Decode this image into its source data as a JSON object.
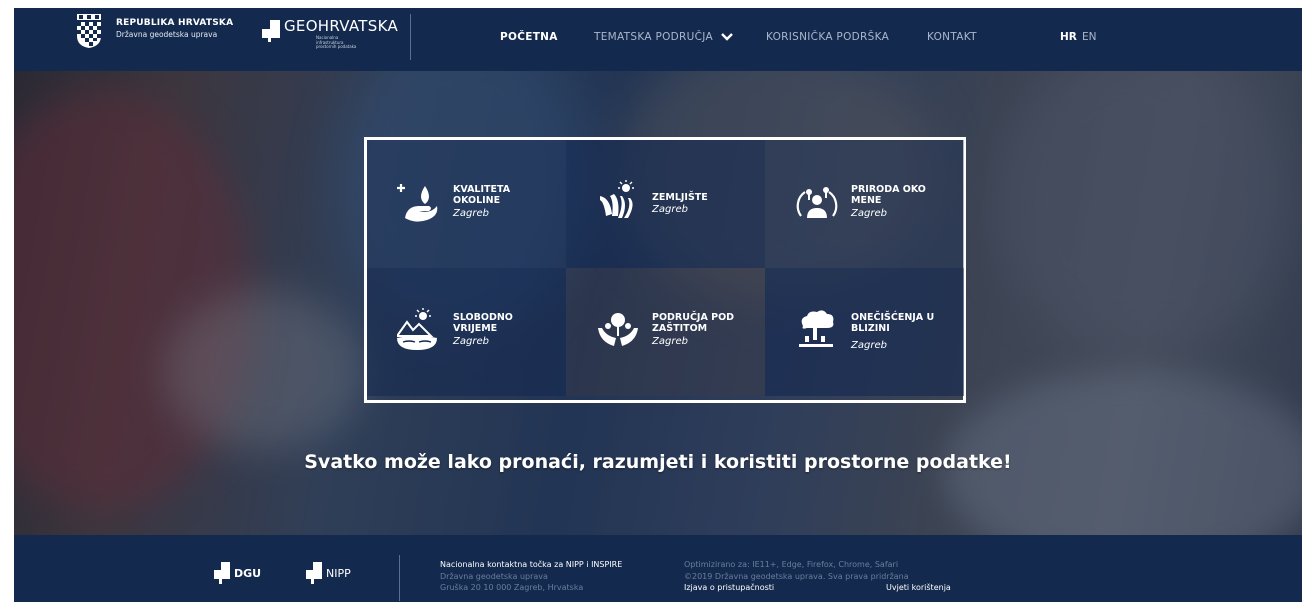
{
  "header": {
    "country": "REPUBLIKA HRVATSKA",
    "agency": "Državna geodetska uprava",
    "geo_title": "GEOHRVATSKA",
    "geo_sub": [
      "Nacionalna infrastruktura",
      "prostornih podataka"
    ],
    "nav": [
      {
        "label": "POČETNA",
        "active": true
      },
      {
        "label": "TEMATSKA PODRUČJA",
        "active": false
      },
      {
        "label": "KORISNIČKA PODRŠKA",
        "active": false
      },
      {
        "label": "KONTAKT",
        "active": false
      }
    ],
    "languages": [
      "HR",
      "EN"
    ]
  },
  "hero": {
    "tiles": [
      {
        "title": "KVALITETA OKOLINE",
        "city": "Zagreb",
        "icon": "hand-drop-icon"
      },
      {
        "title": "ZEMLJIŠTE",
        "city": "Zagreb",
        "icon": "field-sun-icon"
      },
      {
        "title": "PRIRODA OKO MENE",
        "city": "Zagreb",
        "icon": "person-nature-icon"
      },
      {
        "title": "SLOBODNO VRIJEME",
        "city": "Zagreb",
        "icon": "mountain-lake-icon"
      },
      {
        "title": "PODRUČJA POD ZAŠTITOM",
        "city": "Zagreb",
        "icon": "protected-tree-icon"
      },
      {
        "title": "ONEČIŠĆENJA U BLIZINI",
        "city": "Zagreb",
        "icon": "factory-smoke-icon"
      }
    ],
    "tagline": "Svatko može lako pronaći, razumjeti i koristiti prostorne podatke!"
  },
  "footer": {
    "logos": [
      "DGU",
      "NIPP"
    ],
    "contact": {
      "title": "Nacionalna kontaktna točka za NIPP i INSPIRE",
      "line2": "Državna geodetska uprava",
      "line3": "Gruška 20 10 000 Zagreb, Hrvatska"
    },
    "info": {
      "line1": "Optimizirano za: IE11+, Edge, Firefox, Chrome, Safari",
      "line2": "©2019 Državna geodetska uprava. Sva prava pridržana"
    },
    "links": [
      "Izjava o pristupačnosti",
      "Uvjeti korištenja"
    ]
  }
}
